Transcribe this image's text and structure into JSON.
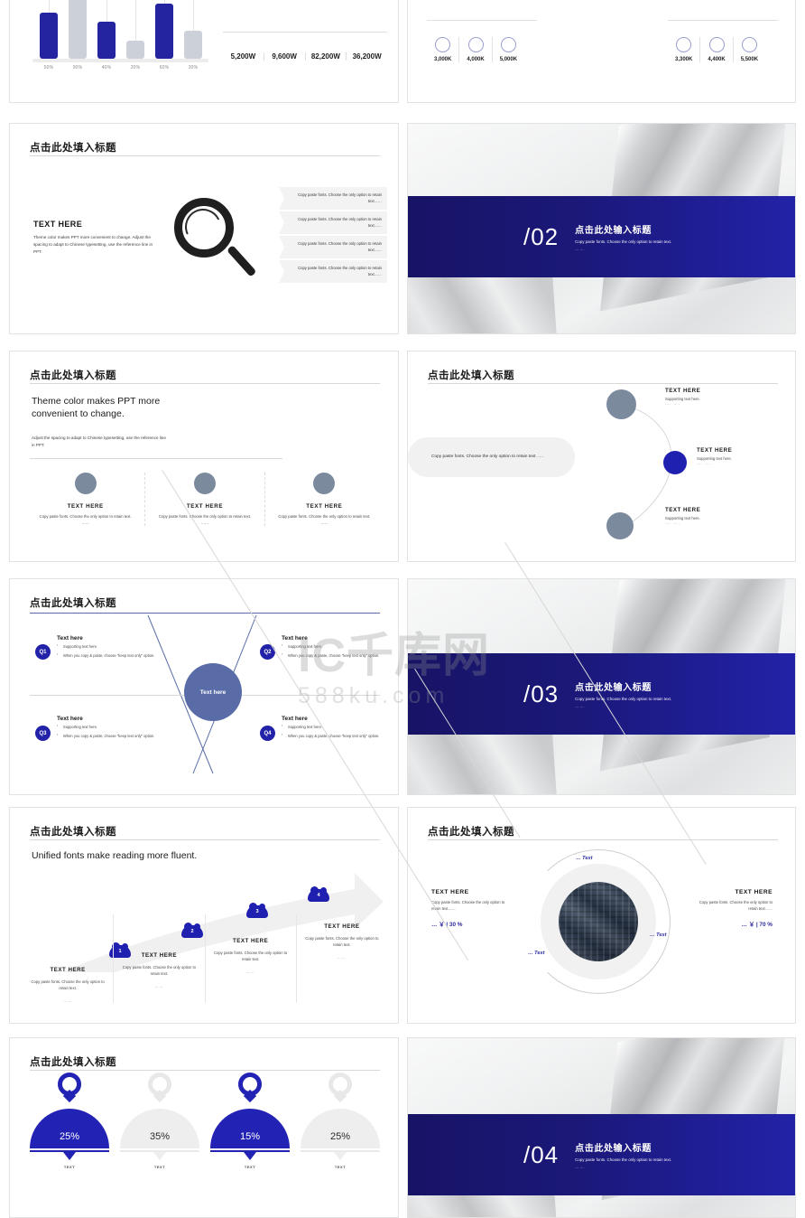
{
  "watermark": {
    "top": "IC千库网",
    "bottom": "588ku.com"
  },
  "slides": {
    "bar_kpi": {
      "kpi": [
        "5,200W",
        "9,600W",
        "82,200W",
        "36,200W"
      ]
    },
    "circle_kpi": {
      "left": [
        "3,000K",
        "4,000K",
        "5,000K"
      ],
      "right": [
        "3,300K",
        "4,400K",
        "5,500K"
      ]
    },
    "magnifier": {
      "title": "点击此处填入标题",
      "heading": "TEXT HERE",
      "body": "Theme color makes PPT more convenient to change. Adjust the spacing to adapt to Chinese typesetting, use the reference line in PPT.",
      "chevrons": [
        "Copy paste fonts. Choose the only option to retain text……",
        "Copy paste fonts. Choose the only option to retain text……",
        "Copy paste fonts. Choose the only option to retain text……",
        "Copy paste fonts. Choose the only option to retain text……"
      ]
    },
    "section_02": {
      "number": "/02",
      "title": "点击此处输入标题",
      "sub": "Copy paste fonts. Choose the only option to retain text.",
      "dots": "……"
    },
    "three_circles": {
      "title": "点击此处填入标题",
      "heading": "Theme color makes PPT more convenient to change.",
      "sub": "Adjust the spacing to adapt to Chinese typesetting, use the reference line in PPT.",
      "items": [
        {
          "label": "TEXT HERE",
          "text": "Copy paste fonts. Choose the only option to retain text.",
          "dots": "……"
        },
        {
          "label": "TEXT HERE",
          "text": "Copy paste fonts. Choose the only option to retain text.",
          "dots": "……"
        },
        {
          "label": "TEXT HERE",
          "text": "Copy paste fonts. Choose the only option to retain text.",
          "dots": "……"
        }
      ]
    },
    "timeline": {
      "title": "点击此处填入标题",
      "bubble": "Copy paste fonts. Choose the only option to retain text. ….",
      "nodes": [
        {
          "label": "TEXT HERE",
          "text": "Supporting text here.",
          "dots": "…. …."
        },
        {
          "label": "TEXT HERE",
          "text": "Supporting text here.",
          "dots": "…. …."
        },
        {
          "label": "TEXT HERE",
          "text": "Supporting text here.",
          "dots": "…. …."
        }
      ]
    },
    "quadrant": {
      "title": "点击此处填入标题",
      "hub": "Text here",
      "items": [
        {
          "badge": "Q1",
          "heading": "Text here",
          "b1": "Supporting text here.",
          "b2": "When you copy & paste, choose \"keep text only\" option."
        },
        {
          "badge": "Q2",
          "heading": "Text here",
          "b1": "Supporting text here.",
          "b2": "When you copy & paste, choose \"keep text only\" option."
        },
        {
          "badge": "Q3",
          "heading": "Text here",
          "b1": "Supporting text here.",
          "b2": "When you copy & paste, choose \"keep text only\" option."
        },
        {
          "badge": "Q4",
          "heading": "Text here",
          "b1": "Supporting text here.",
          "b2": "When you copy & paste, choose \"keep text only\" option."
        }
      ]
    },
    "section_03": {
      "number": "/03",
      "title": "点击此处输入标题",
      "sub": "Copy paste fonts. Choose the only option to retain text.",
      "dots": "……"
    },
    "roadmap": {
      "title": "点击此处填入标题",
      "heading": "Unified fonts make reading more fluent.",
      "steps": [
        {
          "num": "1",
          "label": "TEXT HERE",
          "text": "Copy paste fonts. Choose the only option to retain text.",
          "dots": "……"
        },
        {
          "num": "2",
          "label": "TEXT HERE",
          "text": "Copy paste fonts. Choose the only option to retain text.",
          "dots": "……"
        },
        {
          "num": "3",
          "label": "TEXT HERE",
          "text": "Copy paste fonts. Choose the only option to retain text.",
          "dots": "……"
        },
        {
          "num": "4",
          "label": "TEXT HERE",
          "text": "Copy paste fonts. Choose the only option to retain text.",
          "dots": "……"
        }
      ]
    },
    "donut": {
      "title": "点击此处填入标题",
      "ring_labels": [
        "… Text",
        "… Text",
        "… Text"
      ],
      "left": {
        "heading": "TEXT HERE",
        "text": "Copy paste fonts. Choose the only option to retain text……",
        "value": "… ￥ | 30 %"
      },
      "right": {
        "heading": "TEXT HERE",
        "text": "Copy paste fonts. Choose the only option to retain text……",
        "value": "… ￥ | 70 %"
      }
    },
    "percent": {
      "title": "点击此处填入标题",
      "items": [
        {
          "value": "25%",
          "label": "TEXT",
          "active": true
        },
        {
          "value": "35%",
          "label": "TEXT",
          "active": false
        },
        {
          "value": "15%",
          "label": "TEXT",
          "active": true
        },
        {
          "value": "25%",
          "label": "TEXT",
          "active": false
        }
      ]
    },
    "section_04": {
      "number": "/04",
      "title": "点击此处输入标题",
      "sub": "Copy paste fonts. Choose the only option to retain text.",
      "dots": "……"
    }
  },
  "chart_data": {
    "type": "bar",
    "title": "",
    "categories": [
      "50%",
      "90%",
      "40%",
      "20%",
      "60%",
      "30%"
    ],
    "values": [
      50,
      90,
      40,
      20,
      60,
      30
    ],
    "colors": [
      "#2424a0",
      "#ccd0d8",
      "#2424a0",
      "#ccd0d8",
      "#2424a0",
      "#ccd0d8"
    ],
    "xlabel": "",
    "ylabel": "",
    "ylim": [
      0,
      100
    ]
  }
}
